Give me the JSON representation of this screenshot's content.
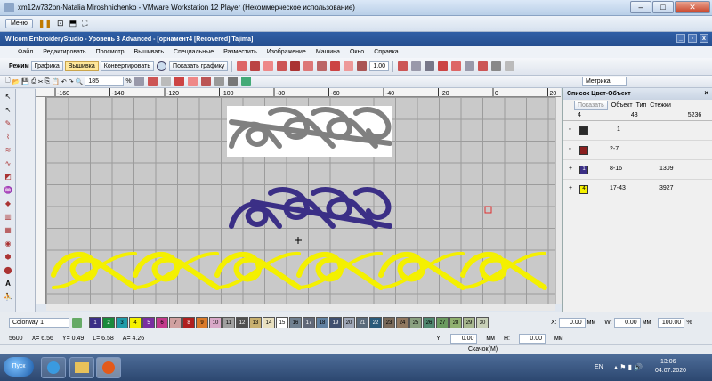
{
  "vm": {
    "title": "xm12w732pn-Natalia Miroshnichenko - VMware Workstation 12 Player (Некоммерческое использование)",
    "menu_label": "Меню"
  },
  "app": {
    "title": "Wilcom EmbroideryStudio - Уровень 3 Advanced - [орнамент4 [Recovered]      Tajima]",
    "menus": [
      "Файл",
      "Редактировать",
      "Просмотр",
      "Вышивать",
      "Специальные",
      "Разместить",
      "Изображение",
      "Машина",
      "Окно",
      "Справка"
    ]
  },
  "toolbar1": {
    "mode_label": "Режим",
    "graphics": "Графика",
    "embroidery": "Вышивка",
    "convert": "Конвертировать",
    "show_graphics": "Показать графику",
    "value": "1.00"
  },
  "toolbar2": {
    "zoom": "185",
    "zoom_unit": "%",
    "metric": "Метрика"
  },
  "ruler": {
    "ticks": [
      "-160",
      "-140",
      "-120",
      "-100",
      "-80",
      "-60",
      "-40",
      "-20",
      "0",
      "20",
      "40",
      "60"
    ]
  },
  "color_panel": {
    "title": "Список Цвет-Объект",
    "show_btn": "Показать",
    "col_obj": "Объект",
    "col_type": "Тип",
    "col_stitches": "Стежки",
    "header_row": {
      "a": "4",
      "b": "43",
      "c": "5236"
    },
    "rows": [
      {
        "range": "1",
        "stitches": "",
        "swatch": "#2b2b2b",
        "num": ""
      },
      {
        "range": "2-7",
        "stitches": "",
        "swatch": "#8a1f1f",
        "num": ""
      },
      {
        "range": "8-16",
        "stitches": "1309",
        "swatch": "#3b2f86",
        "num": "1"
      },
      {
        "range": "17-43",
        "stitches": "3927",
        "swatch": "#f4f000",
        "num": "4"
      }
    ]
  },
  "palette": {
    "colorway": "Colorway 1",
    "colors": [
      {
        "n": "1",
        "c": "#3b2f86"
      },
      {
        "n": "2",
        "c": "#1a8a3c"
      },
      {
        "n": "3",
        "c": "#1f9aa8"
      },
      {
        "n": "4",
        "c": "#f4f000"
      },
      {
        "n": "5",
        "c": "#7a2fa0"
      },
      {
        "n": "6",
        "c": "#c23a8c"
      },
      {
        "n": "7",
        "c": "#d0a0a0"
      },
      {
        "n": "8",
        "c": "#b02020"
      },
      {
        "n": "9",
        "c": "#d97a2a"
      },
      {
        "n": "10",
        "c": "#d8a8c8"
      },
      {
        "n": "11",
        "c": "#a0a0a0"
      },
      {
        "n": "12",
        "c": "#505050"
      },
      {
        "n": "13",
        "c": "#c8b070"
      },
      {
        "n": "14",
        "c": "#e8e0c0"
      },
      {
        "n": "15",
        "c": "#ffffff"
      },
      {
        "n": "16",
        "c": "#708090"
      },
      {
        "n": "17",
        "c": "#606878"
      },
      {
        "n": "18",
        "c": "#6080a0"
      },
      {
        "n": "19",
        "c": "#405070"
      },
      {
        "n": "20",
        "c": "#a0a8b8"
      },
      {
        "n": "21",
        "c": "#5a6a7a"
      },
      {
        "n": "22",
        "c": "#2a5a7a"
      },
      {
        "n": "23",
        "c": "#7a6a5a"
      },
      {
        "n": "24",
        "c": "#907860"
      },
      {
        "n": "25",
        "c": "#8aa080"
      },
      {
        "n": "26",
        "c": "#508870"
      },
      {
        "n": "27",
        "c": "#6a9a60"
      },
      {
        "n": "28",
        "c": "#90b070"
      },
      {
        "n": "29",
        "c": "#a8b890"
      },
      {
        "n": "30",
        "c": "#c8d0b8"
      }
    ],
    "x_label": "X:",
    "y_label": "Y:",
    "x_val": "0.00",
    "y_val": "0.00",
    "unit": "мм",
    "w_label": "W:",
    "h_label": "H:",
    "w_val": "0.00",
    "h_val": "0.00",
    "pct": "100.00",
    "pct_unit": "%"
  },
  "coords": {
    "stitches": "5600",
    "x": "X=  6.56",
    "y": "Y=  0.49",
    "l": "L=  6.58",
    "a": "A=  4.26"
  },
  "status": {
    "text": "Скачок(M)"
  },
  "taskbar": {
    "start": "Пуск",
    "lang": "EN",
    "time": "13:06",
    "date": "04.07.2020"
  },
  "colors": {
    "gray_motif": "#808080",
    "navy_motif": "#3b2f86",
    "yellow_motif": "#f4f000"
  }
}
